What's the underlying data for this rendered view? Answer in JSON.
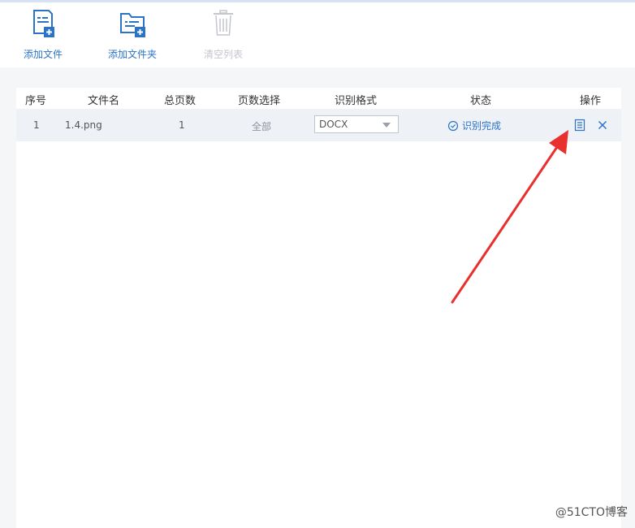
{
  "toolbar": {
    "add_file_label": "添加文件",
    "add_folder_label": "添加文件夹",
    "clear_list_label": "清空列表"
  },
  "table": {
    "headers": [
      "序号",
      "文件名",
      "总页数",
      "页数选择",
      "识别格式",
      "状态",
      "操作"
    ],
    "rows": [
      {
        "index": "1",
        "filename": "1.4.png",
        "total_pages": "1",
        "page_selection": "全部",
        "format": "DOCX",
        "status": "识别完成"
      }
    ]
  },
  "watermark": "@51CTO博客",
  "colors": {
    "accent": "#2b73c7",
    "annotation_arrow": "#e8312f",
    "row_bg": "#eef1f6"
  }
}
